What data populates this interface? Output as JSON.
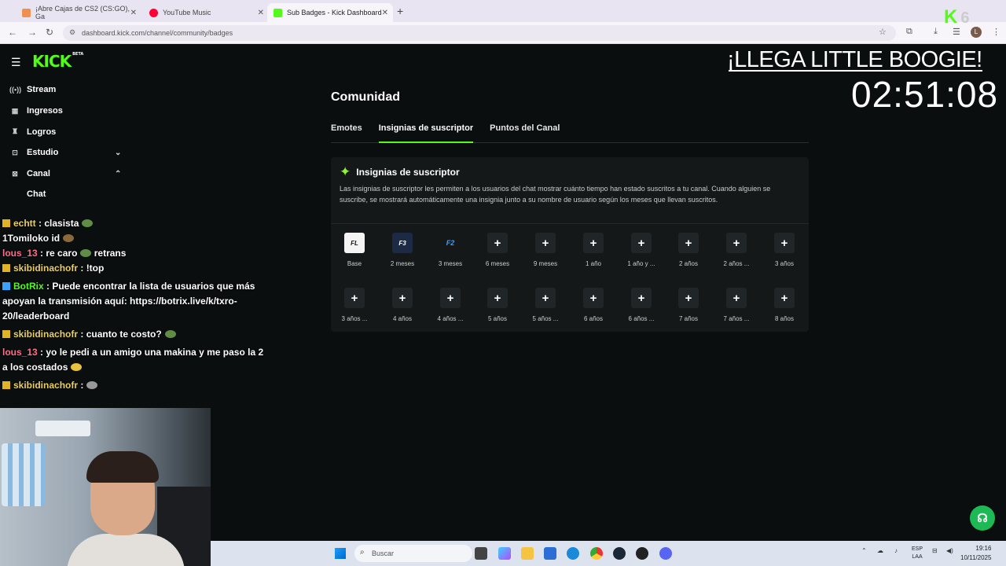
{
  "browser": {
    "tabs": [
      {
        "label": "¡Abre Cajas de CS2 (CS:GO), Ga",
        "fav_color": "#f09050"
      },
      {
        "label": "YouTube Music",
        "fav_color": "#ff0033"
      },
      {
        "label": "Sub Badges - Kick Dashboard",
        "fav_color": "#53fc18"
      }
    ],
    "url": "dashboard.kick.com/channel/community/badges",
    "profile_initial": "L"
  },
  "app": {
    "logo": "KICK",
    "logo_tag": "BETA",
    "sidebar": [
      {
        "label": "Stream",
        "icon": "broadcast-icon"
      },
      {
        "label": "Ingresos",
        "icon": "money-icon"
      },
      {
        "label": "Logros",
        "icon": "trophy-icon"
      },
      {
        "label": "Estudio",
        "icon": "studio-icon"
      },
      {
        "label": "Canal",
        "icon": "channel-icon"
      }
    ],
    "sidebar_sub": [
      "Chat"
    ],
    "page_title": "Comunidad",
    "tabs": [
      "Emotes",
      "Insignias de suscriptor",
      "Puntos del Canal"
    ],
    "card": {
      "title": "Insignias de suscriptor",
      "description": "Las insignias de suscriptor les permiten a los usuarios del chat mostrar cuánto tiempo han estado suscritos a tu canal. Cuando alguien se suscribe, se mostrará automáticamente una insignia junto a su nombre de usuario según los meses que llevan suscritos.",
      "badges_row1": [
        "Base",
        "2 meses",
        "3 meses",
        "6 meses",
        "9 meses",
        "1 año",
        "1 año y ...",
        "2 años",
        "2 años ...",
        "3 años"
      ],
      "badges_row2": [
        "3 años ...",
        "4 años",
        "4 años ...",
        "5 años",
        "5 años ...",
        "6 años",
        "6 años ...",
        "7 años",
        "7 años ...",
        "8 años"
      ],
      "badge_images": {
        "base": "FL",
        "m2": "F3",
        "m3": "F2"
      }
    }
  },
  "overlay": {
    "title": "¡LLEGA LITTLE BOOGIE!",
    "timer": "02:51:08",
    "kick_counter": "6"
  },
  "chat": [
    {
      "user": "echtt",
      "text": ": clasista",
      "color": "user-a"
    },
    {
      "user": "1Tomiloko",
      "text": "id",
      "color": "user-a"
    },
    {
      "user": "lous_13",
      "text": ": re caro",
      "extra": "retrans",
      "color": "user-c"
    },
    {
      "user": "skibidinachofr",
      "text": ": !top",
      "color": "user-a"
    },
    {
      "user": "BotRix",
      "text": ": Puede encontrar la lista de usuarios que más apoyan la transmisión aquí: https://botrix.live/k/txro-20/leaderboard",
      "color": "user-b"
    },
    {
      "user": "skibidinachofr",
      "text": ": cuanto te costo?",
      "color": "user-a"
    },
    {
      "user": "lous_13",
      "text": ": yo le pedi a un amigo una makina y me paso la 2 a los costados",
      "color": "user-c"
    },
    {
      "user": "skibidinachofr",
      "text": ":",
      "color": "user-a"
    }
  ],
  "taskbar": {
    "search_placeholder": "Buscar",
    "lang_top": "ESP",
    "lang_bottom": "LAA",
    "time": "19:16",
    "date": "10/11/2025"
  },
  "colors": {
    "accent": "#53fc18",
    "background": "#0b0e0f",
    "card": "#141819"
  }
}
